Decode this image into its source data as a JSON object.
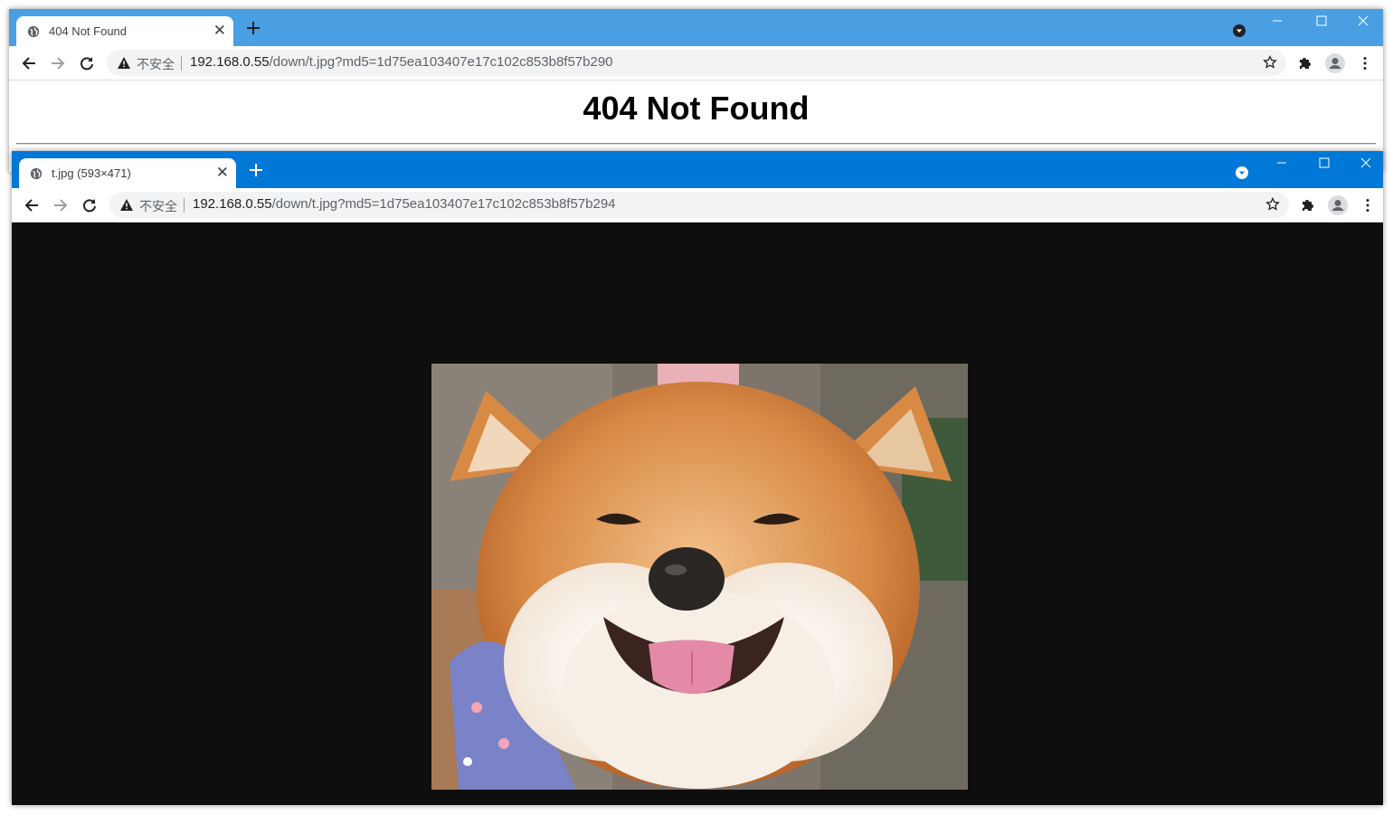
{
  "back_window": {
    "tab_title": "404 Not Found",
    "tab_close": "✕",
    "security_label": "不安全",
    "url_host": "192.168.0.55",
    "url_path": "/down/t.jpg?md5=1d75ea103407e17c102c853b8f57b290",
    "page_heading": "404 Not Found",
    "titlebar_color": "#4a9fe3"
  },
  "front_window": {
    "tab_title": "t.jpg (593×471)",
    "tab_close": "✕",
    "security_label": "不安全",
    "url_host": "192.168.0.55",
    "url_path": "/down/t.jpg?md5=1d75ea103407e17c102c853b8f57b294",
    "titlebar_color": "#0078d7",
    "viewer_background": "#0e0e0e"
  },
  "icons": [
    "globe-icon",
    "plus-icon",
    "dropdown-icon",
    "minimize-icon",
    "maximize-icon",
    "close-icon",
    "back-arrow-icon",
    "forward-arrow-icon",
    "reload-icon",
    "warning-icon",
    "star-icon",
    "puzzle-icon",
    "profile-icon",
    "kebab-menu-icon"
  ]
}
